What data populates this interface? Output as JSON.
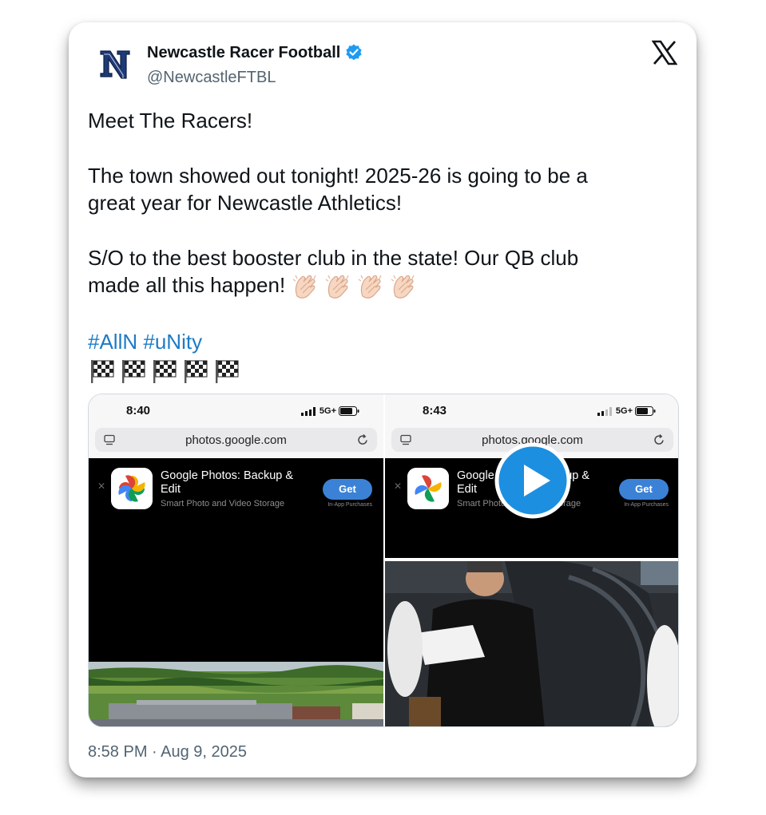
{
  "tweet": {
    "display_name": "Newcastle Racer Football",
    "handle": "@NewcastleFTBL",
    "lines": {
      "l1": "Meet The Racers!",
      "l2": "The town showed out tonight! 2025-26 is going to be a",
      "l3": "great year for Newcastle Athletics!",
      "l4": "S/O to the best booster club in the state! Our QB club",
      "l5": "made all this happen! "
    },
    "hashtags": [
      "#AllN",
      "#uNity"
    ],
    "clap_emoji_count": 4,
    "flag_emoji_count": 5,
    "timestamp": "8:58 PM · Aug 9, 2025"
  },
  "media": {
    "left": {
      "time": "8:40",
      "network": "5G+",
      "url": "photos.google.com",
      "app_title": "Google Photos: Backup & Edit",
      "app_subtitle": "Smart Photo and Video Storage",
      "get_label": "Get",
      "iap_label": "In-App Purchases"
    },
    "right": {
      "time": "8:43",
      "network": "5G+",
      "url": "photos.google.com",
      "app_title": "Google Photos: Backup & Edit",
      "app_subtitle": "Smart Photo and Video Storage",
      "get_label": "Get",
      "iap_label": "In-App Purchases"
    }
  },
  "colors": {
    "hashtag": "#1d7bc7",
    "verified": "#1d9bf0",
    "play_button": "#1d8fe0"
  },
  "icons": [
    "newcastle-n-logo",
    "verified-icon",
    "x-logo-icon",
    "tabs-icon",
    "reload-icon",
    "google-photos-icon",
    "play-icon"
  ]
}
